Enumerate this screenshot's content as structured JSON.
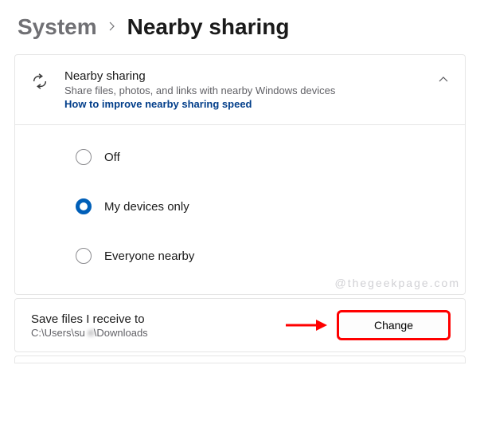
{
  "breadcrumb": {
    "parent": "System",
    "current": "Nearby sharing"
  },
  "sharing_card": {
    "title": "Nearby sharing",
    "description": "Share files, photos, and links with nearby Windows devices",
    "link": "How to improve nearby sharing speed",
    "options": {
      "off": "Off",
      "my_devices": "My devices only",
      "everyone": "Everyone nearby"
    },
    "selected": "my_devices"
  },
  "watermark": "@thegeekpage.com",
  "save_location": {
    "title": "Save files I receive to",
    "path_prefix": "C:\\Users\\su",
    "path_blur": "   ri",
    "path_suffix": "\\Downloads",
    "button": "Change"
  },
  "colors": {
    "accent": "#005fb8",
    "link": "#023e8a",
    "annotation": "#ff0000"
  }
}
